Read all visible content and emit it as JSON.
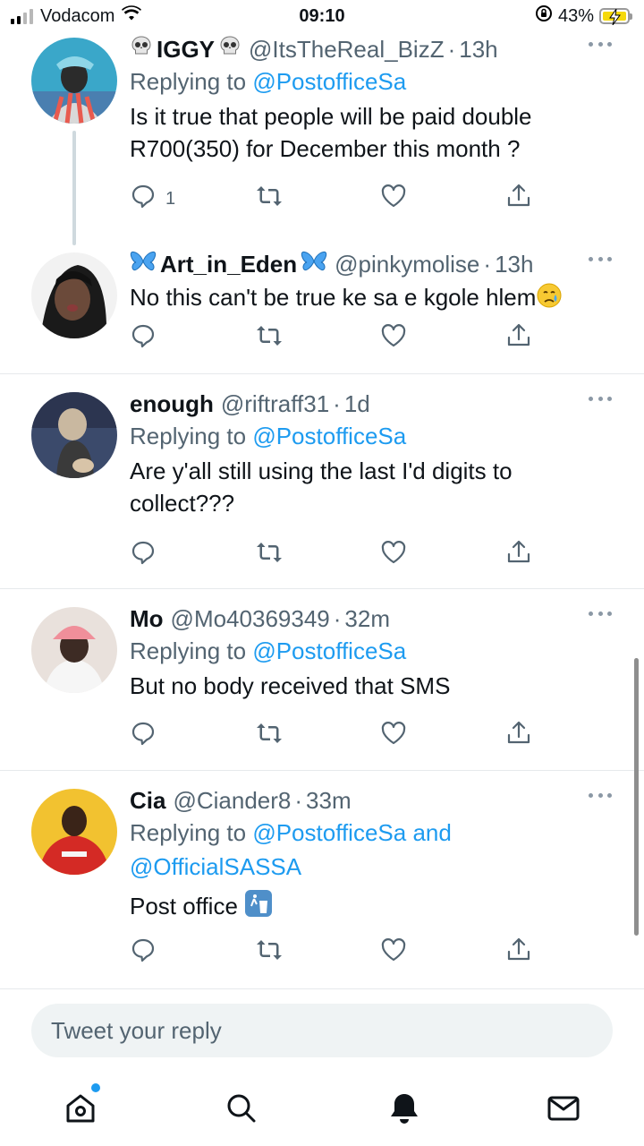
{
  "status_bar": {
    "carrier": "Vodacom",
    "time": "09:10",
    "battery_percent": "43%",
    "signal_bars_filled": 2,
    "signal_bars_total": 4,
    "icons": [
      "signal-icon",
      "wifi-icon",
      "orientation-lock-icon",
      "battery-charging-icon"
    ]
  },
  "tweets": [
    {
      "display_name": "IGGY",
      "name_emoji": "skull",
      "handle": "@ItsTheReal_BizZ",
      "time": "13h",
      "replying_label": "Replying to",
      "replying_to": "@PostofficeSa",
      "text": "Is it true that people will be paid double R700(350) for December this month ?",
      "reply_count": "1",
      "avatar_colors": [
        "#3aa7c9",
        "#e85a4f",
        "#2b2b2b"
      ]
    },
    {
      "display_name": "Art_in_Eden",
      "name_emoji": "butterfly",
      "handle": "@pinkymolise",
      "time": "13h",
      "text": "No this can't be true ke sa e kgole hlem",
      "text_emoji": "crying-face",
      "reply_count": "",
      "avatar_colors": [
        "#f2f2f2",
        "#1a1a1a"
      ]
    },
    {
      "display_name": "enough",
      "handle": "@riftraff31",
      "time": "1d",
      "replying_label": "Replying to",
      "replying_to": "@PostofficeSa",
      "text": "Are y'all still using the last I'd digits to collect???",
      "reply_count": "",
      "avatar_colors": [
        "#3b4a6b",
        "#c9b8a0"
      ]
    },
    {
      "display_name": "Mo",
      "handle": "@Mo40369349",
      "time": "32m",
      "replying_label": "Replying to",
      "replying_to": "@PostofficeSa",
      "text": "But no body received that SMS",
      "reply_count": "",
      "avatar_colors": [
        "#e9e1dc",
        "#f08f9a",
        "#3d2b24"
      ]
    },
    {
      "display_name": "Cia",
      "handle": "@Ciander8",
      "time": "33m",
      "replying_label": "Replying to",
      "replying_to": "@PostofficeSa",
      "replying_and": "and",
      "replying_to_2": "@OfficialSASSA",
      "text": "Post office",
      "text_emoji": "litter-bin",
      "reply_count": "",
      "avatar_colors": [
        "#f2c230",
        "#d42a25",
        "#3a2418"
      ]
    }
  ],
  "reply_box": {
    "placeholder": "Tweet your reply"
  },
  "tab_bar": {
    "items": [
      "home-icon",
      "search-icon",
      "notifications-icon",
      "messages-icon"
    ],
    "home_has_new_indicator": true
  },
  "colors": {
    "accent": "#1d9bf0",
    "secondary_text": "#536471",
    "divider": "#e6e9ec",
    "reply_box_bg": "#eff3f4"
  }
}
